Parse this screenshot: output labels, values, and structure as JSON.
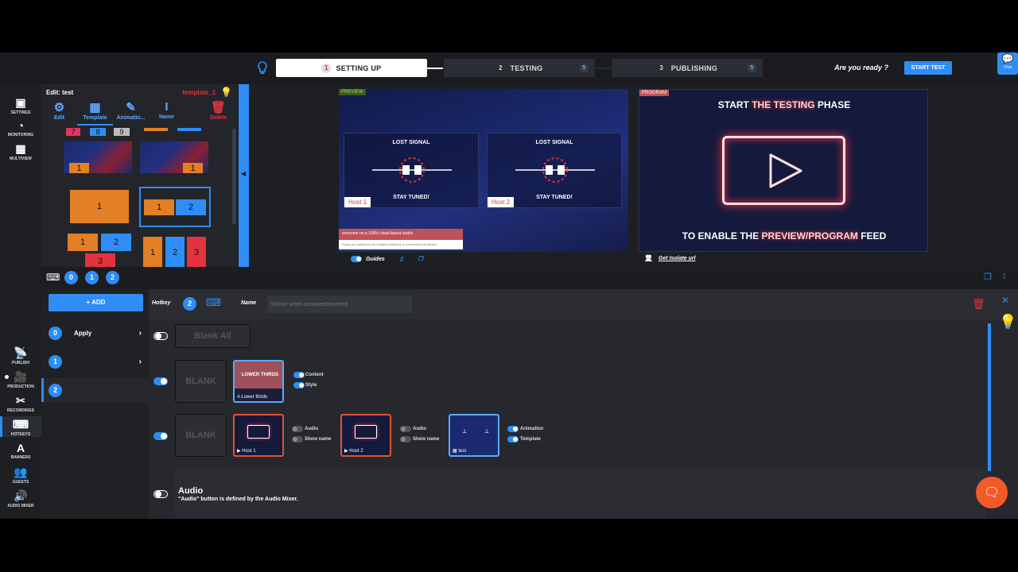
{
  "steps": [
    {
      "num": "1",
      "label": "SETTING UP"
    },
    {
      "num": "2",
      "label": "TESTING",
      "badge": "5"
    },
    {
      "num": "3",
      "label": "PUBLISHING",
      "badge": "5"
    }
  ],
  "ready_text": "Are you ready ?",
  "start_test": "START TEST",
  "chat": "Chat",
  "sidebar_top": [
    {
      "label": "SETTINGS",
      "icon": "settings-icon"
    },
    {
      "label": "MONITORING",
      "icon": "monitoring-icon"
    },
    {
      "label": "MULTIVIEW",
      "icon": "multiview-icon"
    }
  ],
  "sidebar_bottom": [
    {
      "label": "PUBLISH",
      "icon": "publish-icon"
    },
    {
      "label": "PRODUCTION",
      "icon": "production-icon"
    },
    {
      "label": "RECORDINGS",
      "icon": "recordings-icon"
    },
    {
      "label": "HOTKEYS",
      "icon": "hotkeys-icon"
    },
    {
      "label": "BANNERS",
      "icon": "banners-icon"
    },
    {
      "label": "GUESTS",
      "icon": "guests-icon"
    },
    {
      "label": "AUDIO MIXER",
      "icon": "audio-mixer-icon"
    }
  ],
  "template_panel": {
    "title": "Edit: test",
    "template_name": "template_1",
    "tools": [
      "Edit",
      "Template",
      "Animatio...",
      "Name",
      "Delete"
    ]
  },
  "thumb_labels": {
    "a": "1",
    "b": "1",
    "c": "1",
    "d1": "1",
    "d2": "2",
    "e1": "1",
    "e2": "2",
    "e3": "3",
    "f1": "1",
    "f2": "2",
    "f3": "3",
    "top1": "7",
    "top2": "8",
    "top3": "9"
  },
  "preview": {
    "tag": "PREVIEW",
    "host1": "Host 1",
    "host2": "Host 2",
    "lost": "LOST SIGNAL",
    "stay": "STAY TUNED!",
    "banner1": "everyone on a 100% cloud-based studio",
    "banner2": "Easily put audiences on multiple platforms & connections anywhere",
    "guides": "Guides"
  },
  "program": {
    "tag": "PROGRAM",
    "line1a": "START ",
    "line1b": "THE TESTING",
    "line1c": " PHASE",
    "line2a": "TO ENABLE THE ",
    "line2b": "PREVIEW/PROGRAM",
    "line2c": " FEED",
    "isolate": "Get Isolate url"
  },
  "hotkey_tabs": [
    "0",
    "1",
    "2"
  ],
  "add_label": "+ ADD",
  "list": [
    {
      "num": "0",
      "label": "Apply"
    },
    {
      "num": "1",
      "label": ""
    },
    {
      "num": "2",
      "label": ""
    }
  ],
  "hotkey_bar": {
    "hotkey_label": "Hotkey",
    "hotkey_num": "2",
    "name_label": "Name",
    "name_placeholder": "Shown when activated/hovered"
  },
  "rows": {
    "blank_all": "Blank All",
    "blank": "BLANK",
    "lower_thirds_title": "LOWER THIRDS",
    "lower_thirds_label": "Lower thirds",
    "content": "Content",
    "style": "Style",
    "host1": "Host 1",
    "host2": "Host 2",
    "test": "test",
    "audio": "Audio",
    "show_name": "Show name",
    "animation": "Animation",
    "template": "Template"
  },
  "audio_row": {
    "title": "Audio",
    "desc": "\"Audio\" button is defined by the Audio Mixer."
  }
}
